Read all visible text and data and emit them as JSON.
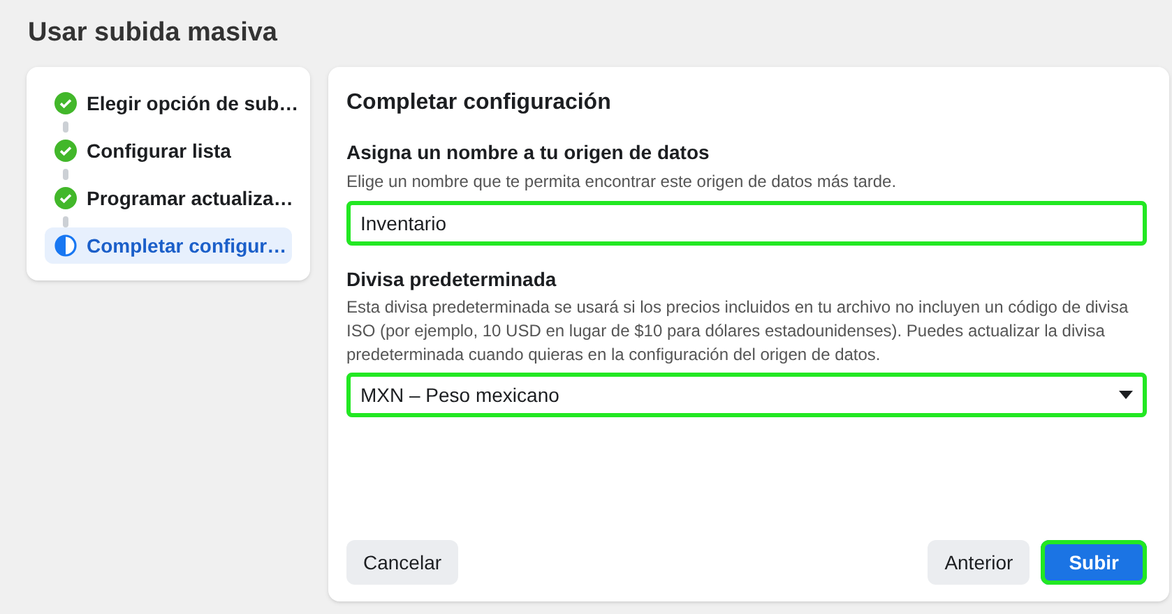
{
  "page_title": "Usar subida masiva",
  "steps": [
    {
      "label": "Elegir opción de sub…",
      "kind": "done",
      "selected": false
    },
    {
      "label": "Configurar lista",
      "kind": "done",
      "selected": false
    },
    {
      "label": "Programar actualiza…",
      "kind": "done",
      "selected": false
    },
    {
      "label": "Completar configur…",
      "kind": "current",
      "selected": true
    }
  ],
  "panel": {
    "title": "Completar configuración",
    "name_section": {
      "label": "Asigna un nombre a tu origen de datos",
      "help": "Elige un nombre que te permita encontrar este origen de datos más tarde.",
      "value": "Inventario",
      "highlighted": true
    },
    "currency_section": {
      "label": "Divisa predeterminada",
      "help": "Esta divisa predeterminada se usará si los precios incluidos en tu archivo no incluyen un código de divisa ISO (por ejemplo, 10 USD en lugar de $10 para dólares estadounidenses). Puedes actualizar la divisa predeterminada cuando quieras en la configuración del origen de datos.",
      "value": "MXN – Peso mexicano",
      "highlighted": true
    },
    "buttons": [
      {
        "label": "Cancelar",
        "kind": "secondary",
        "highlighted": false
      },
      {
        "label": "Anterior",
        "kind": "secondary",
        "highlighted": false
      },
      {
        "label": "Subir",
        "kind": "primary",
        "highlighted": true
      }
    ]
  }
}
